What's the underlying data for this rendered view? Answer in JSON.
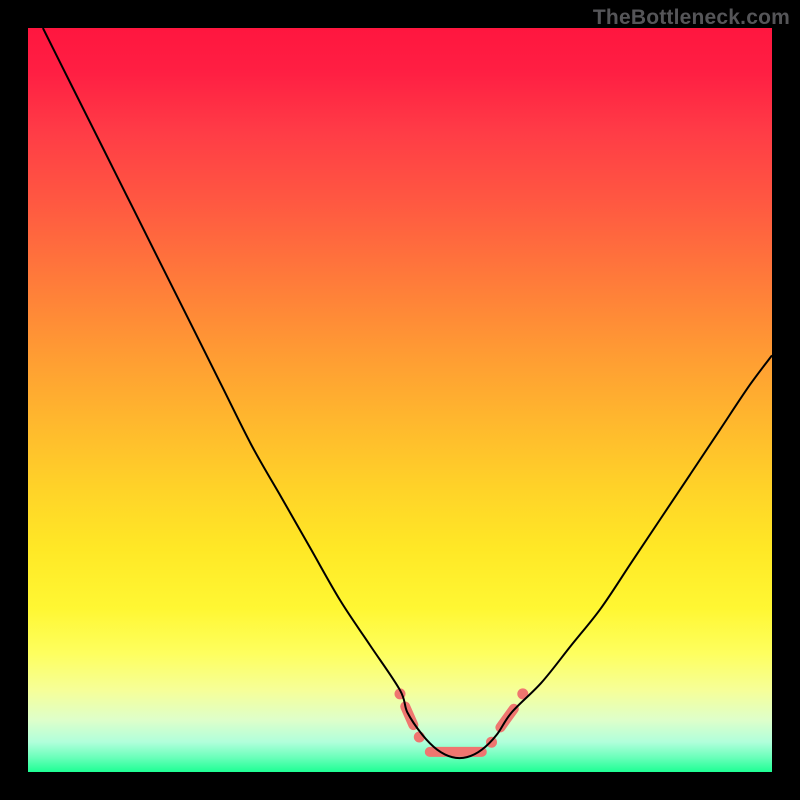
{
  "watermark": "TheBottleneck.com",
  "colors": {
    "frame": "#000000",
    "curve": "#000000",
    "marker": "#ef7670"
  },
  "chart_data": {
    "type": "line",
    "title": "",
    "xlabel": "",
    "ylabel": "",
    "xlim": [
      0,
      100
    ],
    "ylim": [
      0,
      100
    ],
    "grid": false,
    "series": [
      {
        "name": "bottleneck-curve",
        "x": [
          2,
          6,
          10,
          14,
          18,
          22,
          26,
          30,
          34,
          38,
          42,
          46,
          50,
          51,
          53,
          55,
          57,
          59,
          61,
          63,
          65,
          69,
          73,
          77,
          81,
          85,
          89,
          93,
          97,
          100
        ],
        "y": [
          100,
          92,
          84,
          76,
          68,
          60,
          52,
          44,
          37,
          30,
          23,
          17,
          11,
          8,
          5,
          3,
          2,
          2,
          3,
          5,
          8,
          12,
          17,
          22,
          28,
          34,
          40,
          46,
          52,
          56
        ]
      }
    ],
    "markers": [
      {
        "name": "left-dot-upper",
        "type": "dot",
        "x": 50.0,
        "y": 10.5
      },
      {
        "name": "left-short-seg",
        "type": "segment",
        "x1": 50.7,
        "y1": 8.8,
        "x2": 51.8,
        "y2": 6.3
      },
      {
        "name": "left-dot-lower",
        "type": "dot",
        "x": 52.6,
        "y": 4.7
      },
      {
        "name": "bottom-flat-seg",
        "type": "segment",
        "x1": 54.0,
        "y1": 2.7,
        "x2": 61.0,
        "y2": 2.7
      },
      {
        "name": "right-dot-lower",
        "type": "dot",
        "x": 62.3,
        "y": 4.0
      },
      {
        "name": "right-short-seg",
        "type": "segment",
        "x1": 63.5,
        "y1": 6.0,
        "x2": 65.3,
        "y2": 8.5
      },
      {
        "name": "right-dot-upper",
        "type": "dot",
        "x": 66.5,
        "y": 10.5
      }
    ],
    "annotations": []
  }
}
